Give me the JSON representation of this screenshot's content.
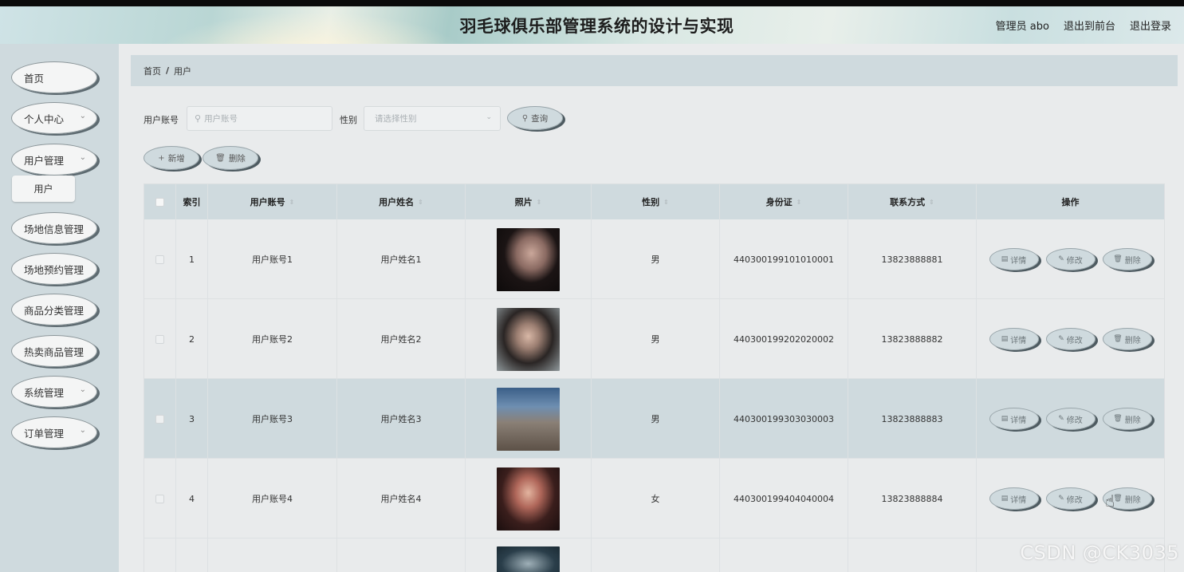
{
  "header": {
    "title": "羽毛球俱乐部管理系统的设计与实现",
    "admin_label": "管理员 abo",
    "front_label": "退出到前台",
    "logout_label": "退出登录"
  },
  "sidebar": {
    "items": [
      {
        "label": "首页",
        "chevron": ""
      },
      {
        "label": "个人中心",
        "chevron": "⌄"
      },
      {
        "label": "用户管理",
        "chevron": "⌄"
      },
      {
        "label": "场地信息管理",
        "chevron": ""
      },
      {
        "label": "场地预约管理",
        "chevron": ""
      },
      {
        "label": "商品分类管理",
        "chevron": ""
      },
      {
        "label": "热卖商品管理",
        "chevron": ""
      },
      {
        "label": "系统管理",
        "chevron": "⌄"
      },
      {
        "label": "订单管理",
        "chevron": "⌄"
      }
    ],
    "sub_item": "用户"
  },
  "breadcrumb": {
    "home": "首页",
    "separator": "/",
    "current": "用户"
  },
  "search": {
    "account_label": "用户账号",
    "account_placeholder": "用户账号",
    "gender_label": "性别",
    "gender_placeholder": "请选择性别",
    "query_label": "查询"
  },
  "actions": {
    "add_label": "新增",
    "delete_label": "删除"
  },
  "table": {
    "headers": [
      "索引",
      "用户账号",
      "用户姓名",
      "照片",
      "性别",
      "身份证",
      "联系方式",
      "操作"
    ],
    "rows": [
      {
        "index": "1",
        "account": "用户账号1",
        "name": "用户姓名1",
        "gender": "男",
        "id_card": "440300199101010001",
        "phone": "13823888881"
      },
      {
        "index": "2",
        "account": "用户账号2",
        "name": "用户姓名2",
        "gender": "男",
        "id_card": "440300199202020002",
        "phone": "13823888882"
      },
      {
        "index": "3",
        "account": "用户账号3",
        "name": "用户姓名3",
        "gender": "男",
        "id_card": "440300199303030003",
        "phone": "13823888883"
      },
      {
        "index": "4",
        "account": "用户账号4",
        "name": "用户姓名4",
        "gender": "女",
        "id_card": "440300199404040004",
        "phone": "13823888884"
      }
    ],
    "row_actions": {
      "detail": "详情",
      "edit": "修改",
      "delete": "删除"
    }
  },
  "watermark": "CSDN @CK3035",
  "colors": {
    "accent": "#cfdade",
    "page_bg": "#e9ebec",
    "button_shadow": "#4e5b61"
  },
  "icons": {
    "search": "search-icon",
    "add": "plus-icon",
    "delete": "trash-icon",
    "detail": "document-icon",
    "edit": "pencil-icon",
    "chevron": "chevron-down-icon"
  }
}
